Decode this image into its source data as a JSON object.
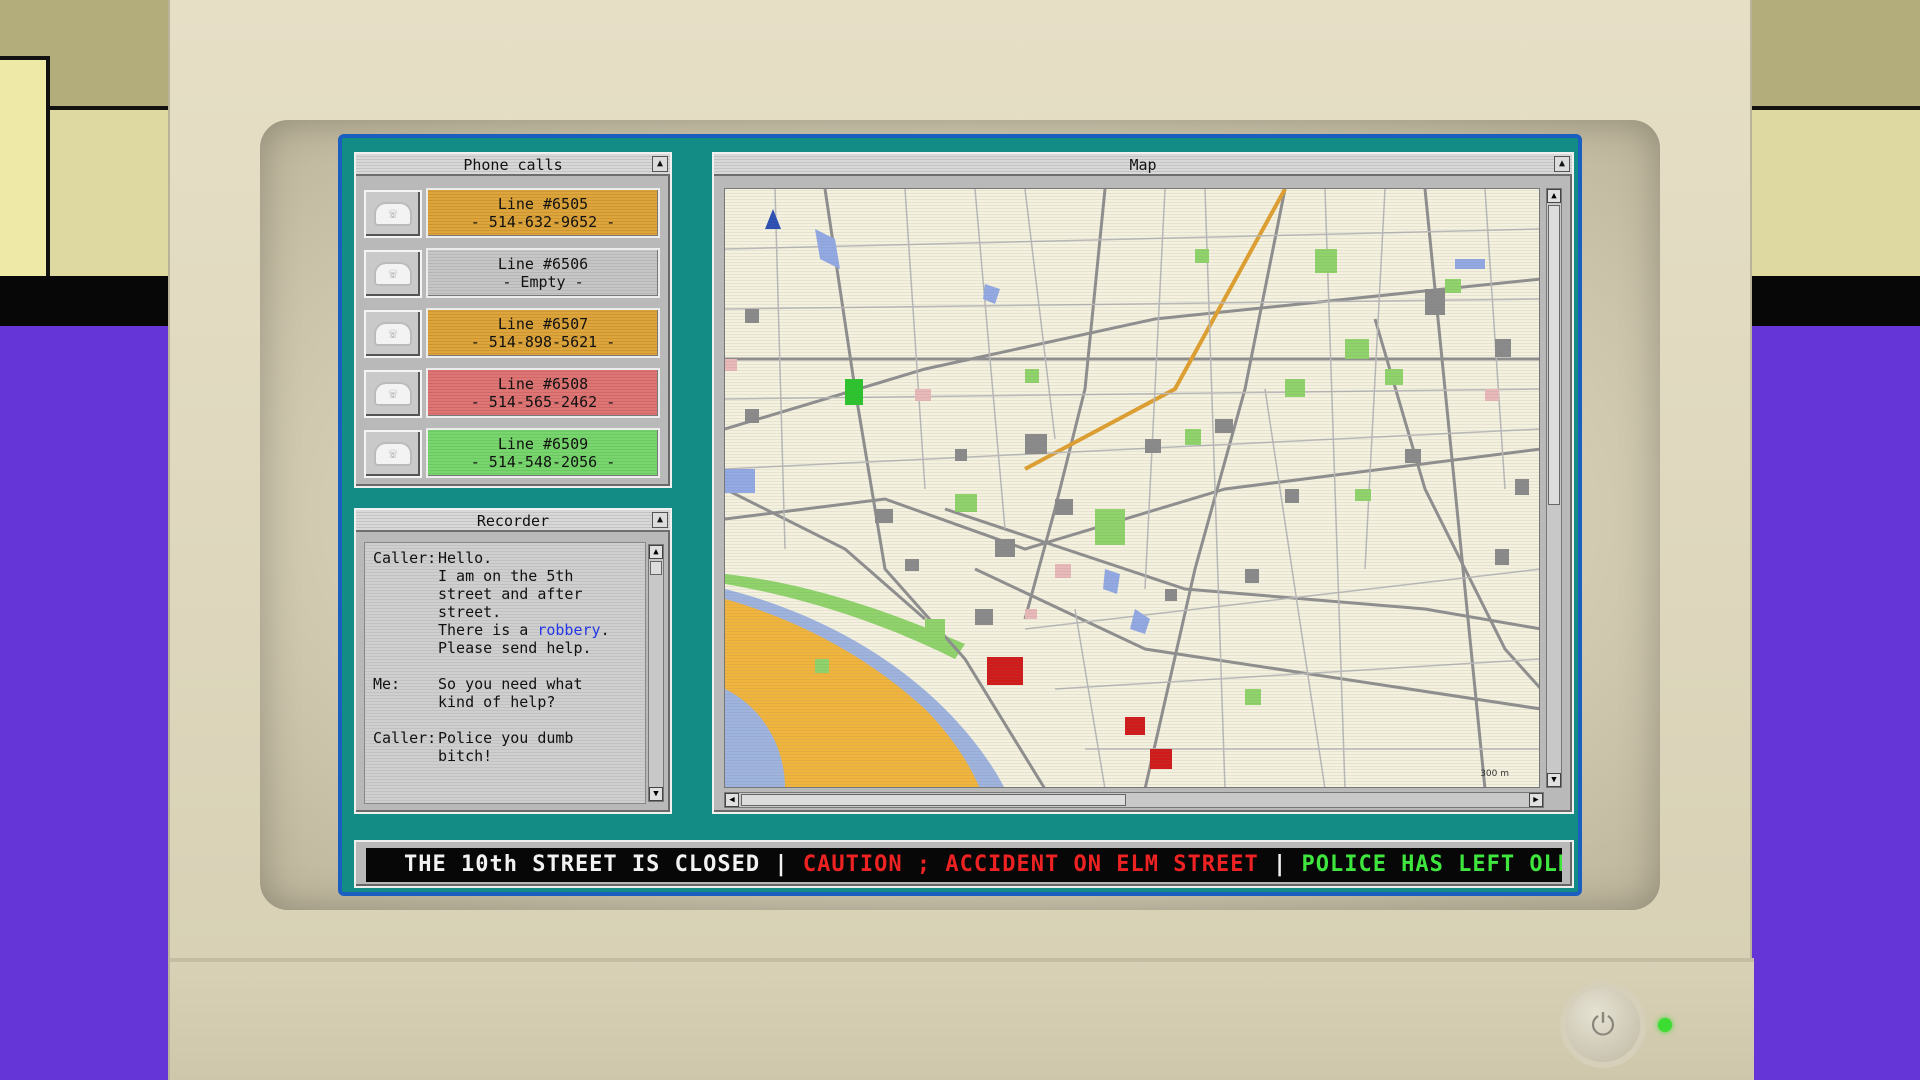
{
  "phone_calls": {
    "title": "Phone calls",
    "lines": [
      {
        "line": "Line #6505",
        "number": "- 514-632-9652 -",
        "status": "orange"
      },
      {
        "line": "Line #6506",
        "number": "- Empty -",
        "status": "grey"
      },
      {
        "line": "Line #6507",
        "number": "- 514-898-5621 -",
        "status": "orange"
      },
      {
        "line": "Line #6508",
        "number": "- 514-565-2462 -",
        "status": "red"
      },
      {
        "line": "Line #6509",
        "number": "- 514-548-2056 -",
        "status": "green"
      }
    ]
  },
  "recorder": {
    "title": "Recorder",
    "entries": [
      {
        "speaker": "Caller:",
        "text_before": "Hello.\nI am on the 5th\nstreet and after\nstreet.\nThere is a ",
        "keyword": "robbery",
        "text_after": ".\nPlease send help."
      },
      {
        "speaker": "Me:",
        "text": "So you need what\nkind of help?"
      },
      {
        "speaker": "Caller:",
        "text": "Police you dumb\nbitch!"
      }
    ]
  },
  "map": {
    "title": "Map",
    "scale_label": "300 m"
  },
  "ticker": {
    "segment_1": "THE 10th STREET IS CLOSED | ",
    "segment_2": "CAUTION ; ACCIDENT ON ELM STREET",
    "segment_3": " | ",
    "segment_4": "POLICE HAS LEFT OLD STREET"
  },
  "colors": {
    "screen_bg": "#128c84",
    "call_orange": "#dca53d",
    "call_red": "#de7676",
    "call_green": "#79d56e",
    "call_grey": "#c6c6c6",
    "ticker_red": "#ee2222",
    "ticker_green": "#3ee63e",
    "power_led": "#3ddc32"
  },
  "icons": [
    "phone-icon",
    "collapse-arrow-icon",
    "scroll-up-icon",
    "scroll-down-icon",
    "scroll-left-icon",
    "scroll-right-icon",
    "north-arrow-icon",
    "power-icon"
  ]
}
